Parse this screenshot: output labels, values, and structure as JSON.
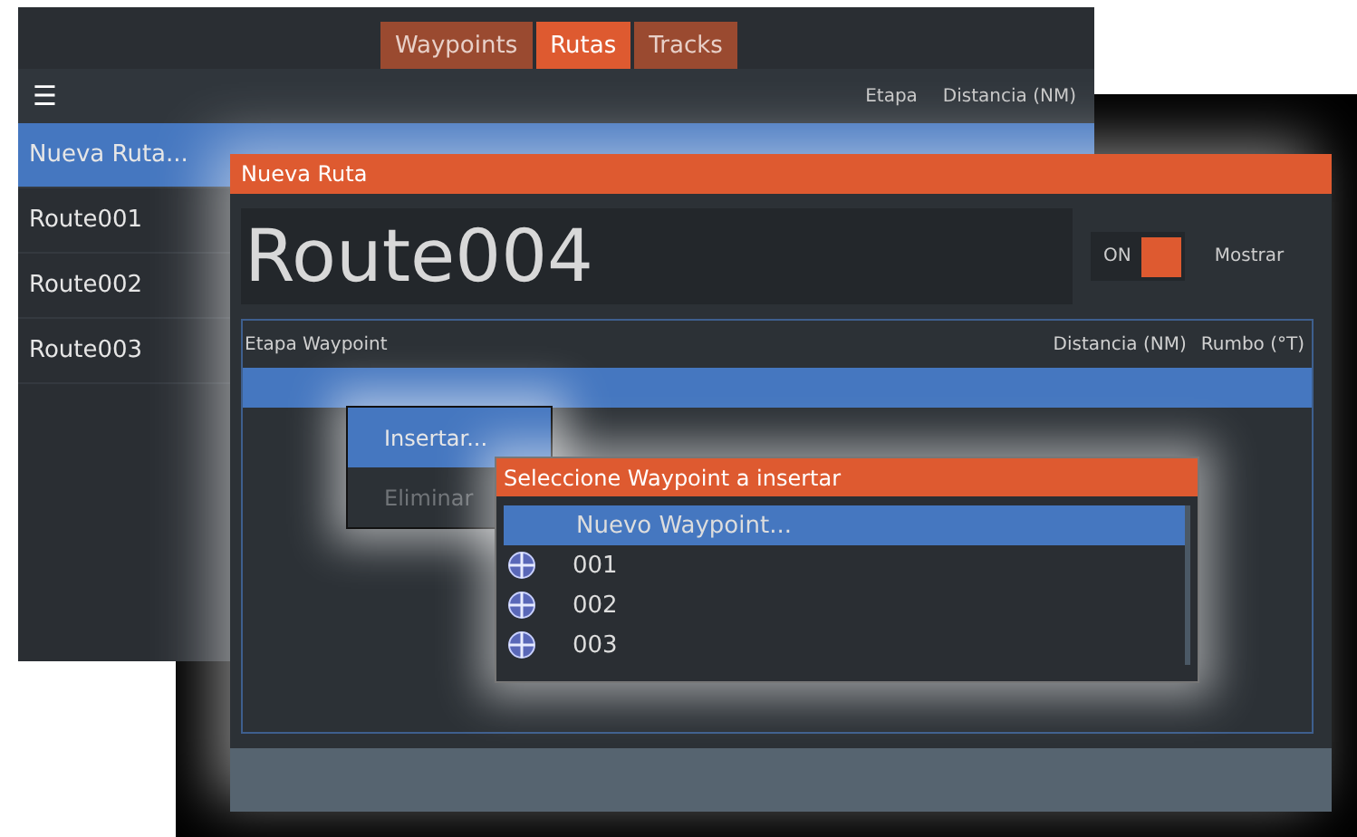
{
  "tabs": [
    {
      "label": "Waypoints",
      "selected": false
    },
    {
      "label": "Rutas",
      "selected": true
    },
    {
      "label": "Tracks",
      "selected": false
    }
  ],
  "route_list": {
    "menu_icon": "☰",
    "columns": [
      "Etapa",
      "Distancia (NM)"
    ],
    "items": [
      {
        "label": "Nueva Ruta...",
        "selected": true
      },
      {
        "label": "Route001",
        "selected": false
      },
      {
        "label": "Route002",
        "selected": false
      },
      {
        "label": "Route003",
        "selected": false
      }
    ]
  },
  "dialog": {
    "title": "Nueva Ruta",
    "name": "Route004",
    "toggle": {
      "label": "ON",
      "on": true
    },
    "show_label": "Mostrar",
    "table": {
      "columns": [
        "Etapa Waypoint",
        "Distancia (NM)",
        "Rumbo (°T)"
      ],
      "rows": [
        {
          "selected": true
        }
      ]
    }
  },
  "context_menu": {
    "items": [
      {
        "label": "Insertar...",
        "selected": true,
        "disabled": false
      },
      {
        "label": "Eliminar",
        "selected": false,
        "disabled": true
      }
    ]
  },
  "picker": {
    "title": "Seleccione Waypoint a insertar",
    "items": [
      {
        "kind": "action",
        "label": "Nuevo Waypoint...",
        "selected": true
      },
      {
        "kind": "waypoint",
        "label": "001",
        "selected": false
      },
      {
        "kind": "waypoint",
        "label": "002",
        "selected": false
      },
      {
        "kind": "waypoint",
        "label": "003",
        "selected": false
      }
    ]
  }
}
